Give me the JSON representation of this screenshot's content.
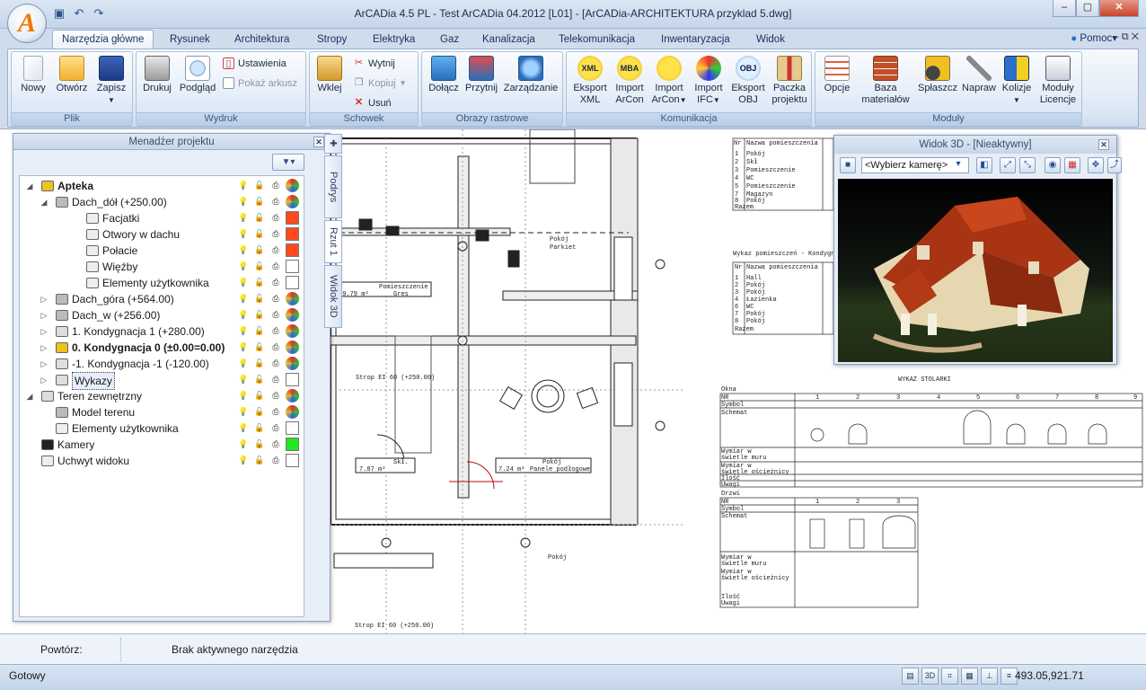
{
  "window": {
    "title": "ArCADia 4.5 PL - Test ArCADia 04.2012 [L01] - [ArCADia-ARCHITEKTURA przyklad 5.dwg]",
    "app_logo": "A",
    "controls": {
      "min": "–",
      "max": "▢",
      "close": "✕"
    }
  },
  "tabs": [
    "Narzędzia główne",
    "Rysunek",
    "Architektura",
    "Stropy",
    "Elektryka",
    "Gaz",
    "Kanalizacja",
    "Telekomunikacja",
    "Inwentaryzacja",
    "Widok"
  ],
  "help": {
    "label": "Pomoc",
    "arrow": "▾",
    "mdi": "– ⧉ ✕"
  },
  "ribbon": {
    "plik": {
      "label": "Plik",
      "nowy": "Nowy",
      "otworz": "Otwórz",
      "zapisz": "Zapisz"
    },
    "wydruk": {
      "label": "Wydruk",
      "drukuj": "Drukuj",
      "podglad": "Podgląd",
      "ustawienia": "Ustawienia",
      "pokaz_arkusz": "Pokaż arkusz"
    },
    "schowek": {
      "label": "Schowek",
      "wklej": "Wklej",
      "wytnij": "Wytnij",
      "kopiuj": "Kopiuj",
      "usun": "Usuń"
    },
    "obrazy": {
      "label": "Obrazy rastrowe",
      "dolacz": "Dołącz",
      "przytnij": "Przytnij",
      "zarzadzanie": "Zarządzanie"
    },
    "komunikacja": {
      "label": "Komunikacja",
      "eksport_xml_1": "Eksport",
      "eksport_xml_2": "XML",
      "import_arcon_1": "Import",
      "import_arcon_2": "ArCon",
      "import_arcon2_1": "Import",
      "import_arcon2_2": "ArCon",
      "import_ifc_1": "Import",
      "import_ifc_2": "IFC",
      "eksport_obj_1": "Eksport",
      "eksport_obj_2": "OBJ",
      "paczka_1": "Paczka",
      "paczka_2": "projektu",
      "xml_tag": "XML",
      "mba_tag": "MBA",
      "obj_tag": "OBJ"
    },
    "moduly": {
      "label": "Moduły",
      "opcje": "Opcje",
      "baza_1": "Baza",
      "baza_2": "materiałów",
      "splaszcz": "Spłaszcz",
      "napraw": "Napraw",
      "kolizje": "Kolizje",
      "moduly_1": "Moduły",
      "moduly_2": "Licencje"
    }
  },
  "project_manager": {
    "title": "Menadżer projektu",
    "close": "✕",
    "filter": "▼▾",
    "vtabs": [
      "Podrys",
      "Rzut 1",
      "Widok 3D"
    ],
    "tree": [
      {
        "label": "Apteka",
        "bold": true,
        "swatch": "#c0409e"
      },
      {
        "label": "Dach_dół (+250.00)",
        "swatch": "#c0409e"
      },
      {
        "label": "Facjatki",
        "swatch": "#ff4a1c"
      },
      {
        "label": "Otwory w dachu",
        "swatch": "#ff4a1c"
      },
      {
        "label": "Połacie",
        "swatch": "#ff4a1c"
      },
      {
        "label": "Więźby",
        "swatch": "#ffffff"
      },
      {
        "label": "Elementy użytkownika",
        "swatch": "#ffffff"
      },
      {
        "label": "Dach_góra (+564.00)",
        "swatch": "#c0409e"
      },
      {
        "label": "Dach_w (+256.00)",
        "swatch": "#c0409e"
      },
      {
        "label": "1. Kondygnacja 1 (+280.00)",
        "swatch": "#c0409e"
      },
      {
        "label": "0. Kondygnacja 0 (±0.00=0.00)",
        "bold": true,
        "swatch": "#c0409e"
      },
      {
        "label": "-1. Kondygnacja -1 (-120.00)",
        "swatch": "#c0409e"
      },
      {
        "label": "Wykazy",
        "swatch": "#ffffff"
      },
      {
        "label": "Teren zewnętrzny",
        "swatch": "#c0409e"
      },
      {
        "label": "Model terenu",
        "swatch": "#c0409e"
      },
      {
        "label": "Elementy użytkownika",
        "swatch": "#ffffff"
      },
      {
        "label": "Kamery",
        "swatch": "#22e822"
      },
      {
        "label": "Uchwyt widoku",
        "swatch": "#ffffff"
      }
    ]
  },
  "view3d": {
    "title": "Widok 3D - [Nieaktywny]",
    "close": "✕",
    "camera_placeholder": "<Wybierz kamerę>"
  },
  "drawing": {
    "room_table_1_header": [
      "Nr",
      "Nazwa pomieszczenia"
    ],
    "room_table_1": [
      [
        "1",
        "Pokój"
      ],
      [
        "2",
        "Skł"
      ],
      [
        "3",
        "Pomieszczenie"
      ],
      [
        "4",
        "WC"
      ],
      [
        "5",
        "Pomieszczenie"
      ],
      [
        "7",
        "Magazyn"
      ],
      [
        "8",
        "Pokój"
      ],
      [
        "",
        "Razem"
      ]
    ],
    "room_table_2_title": "Wykaz pomieszczeń - Kondygnacja",
    "room_table_2": [
      [
        "1",
        "Hall"
      ],
      [
        "2",
        "Pokój"
      ],
      [
        "3",
        "Pokój"
      ],
      [
        "4",
        "Łazienka"
      ],
      [
        "6",
        "WC"
      ],
      [
        "7",
        "Pokój"
      ],
      [
        "8",
        "Pokój"
      ],
      [
        "",
        "Razem"
      ]
    ],
    "stolarka_title": "WYKAZ STOLARKI",
    "okna": "Okna",
    "drzwi": "Drzwi",
    "stolarka_rows": [
      "NR",
      "Symbol",
      "Schemat",
      "Wymiar w",
      "świetle muru",
      "Wymiar w",
      "świetle ościeżnicy",
      "Ilość",
      "Uwagi"
    ],
    "window_cols": [
      "1",
      "2",
      "3",
      "4",
      "5",
      "6",
      "7",
      "8",
      "9"
    ],
    "door_cols": [
      "1",
      "2",
      "3"
    ],
    "plan_labels": [
      "Pokój",
      "Parkiet",
      "Pomieszczenie",
      "49.79 m²",
      "Gres",
      "Strop EI 60 (+250.00)",
      "Skł.",
      "7.87 m²",
      "Pokój",
      "7.24 m²",
      "Panele podłogowe",
      "Pokój",
      "Strop EI 60 (+250.00)"
    ]
  },
  "command": {
    "repeat_label": "Powtórz:",
    "no_tool": "Brak aktywnego narzędzia"
  },
  "status": {
    "text": "Gotowy",
    "coords": "493.05,921.71"
  }
}
